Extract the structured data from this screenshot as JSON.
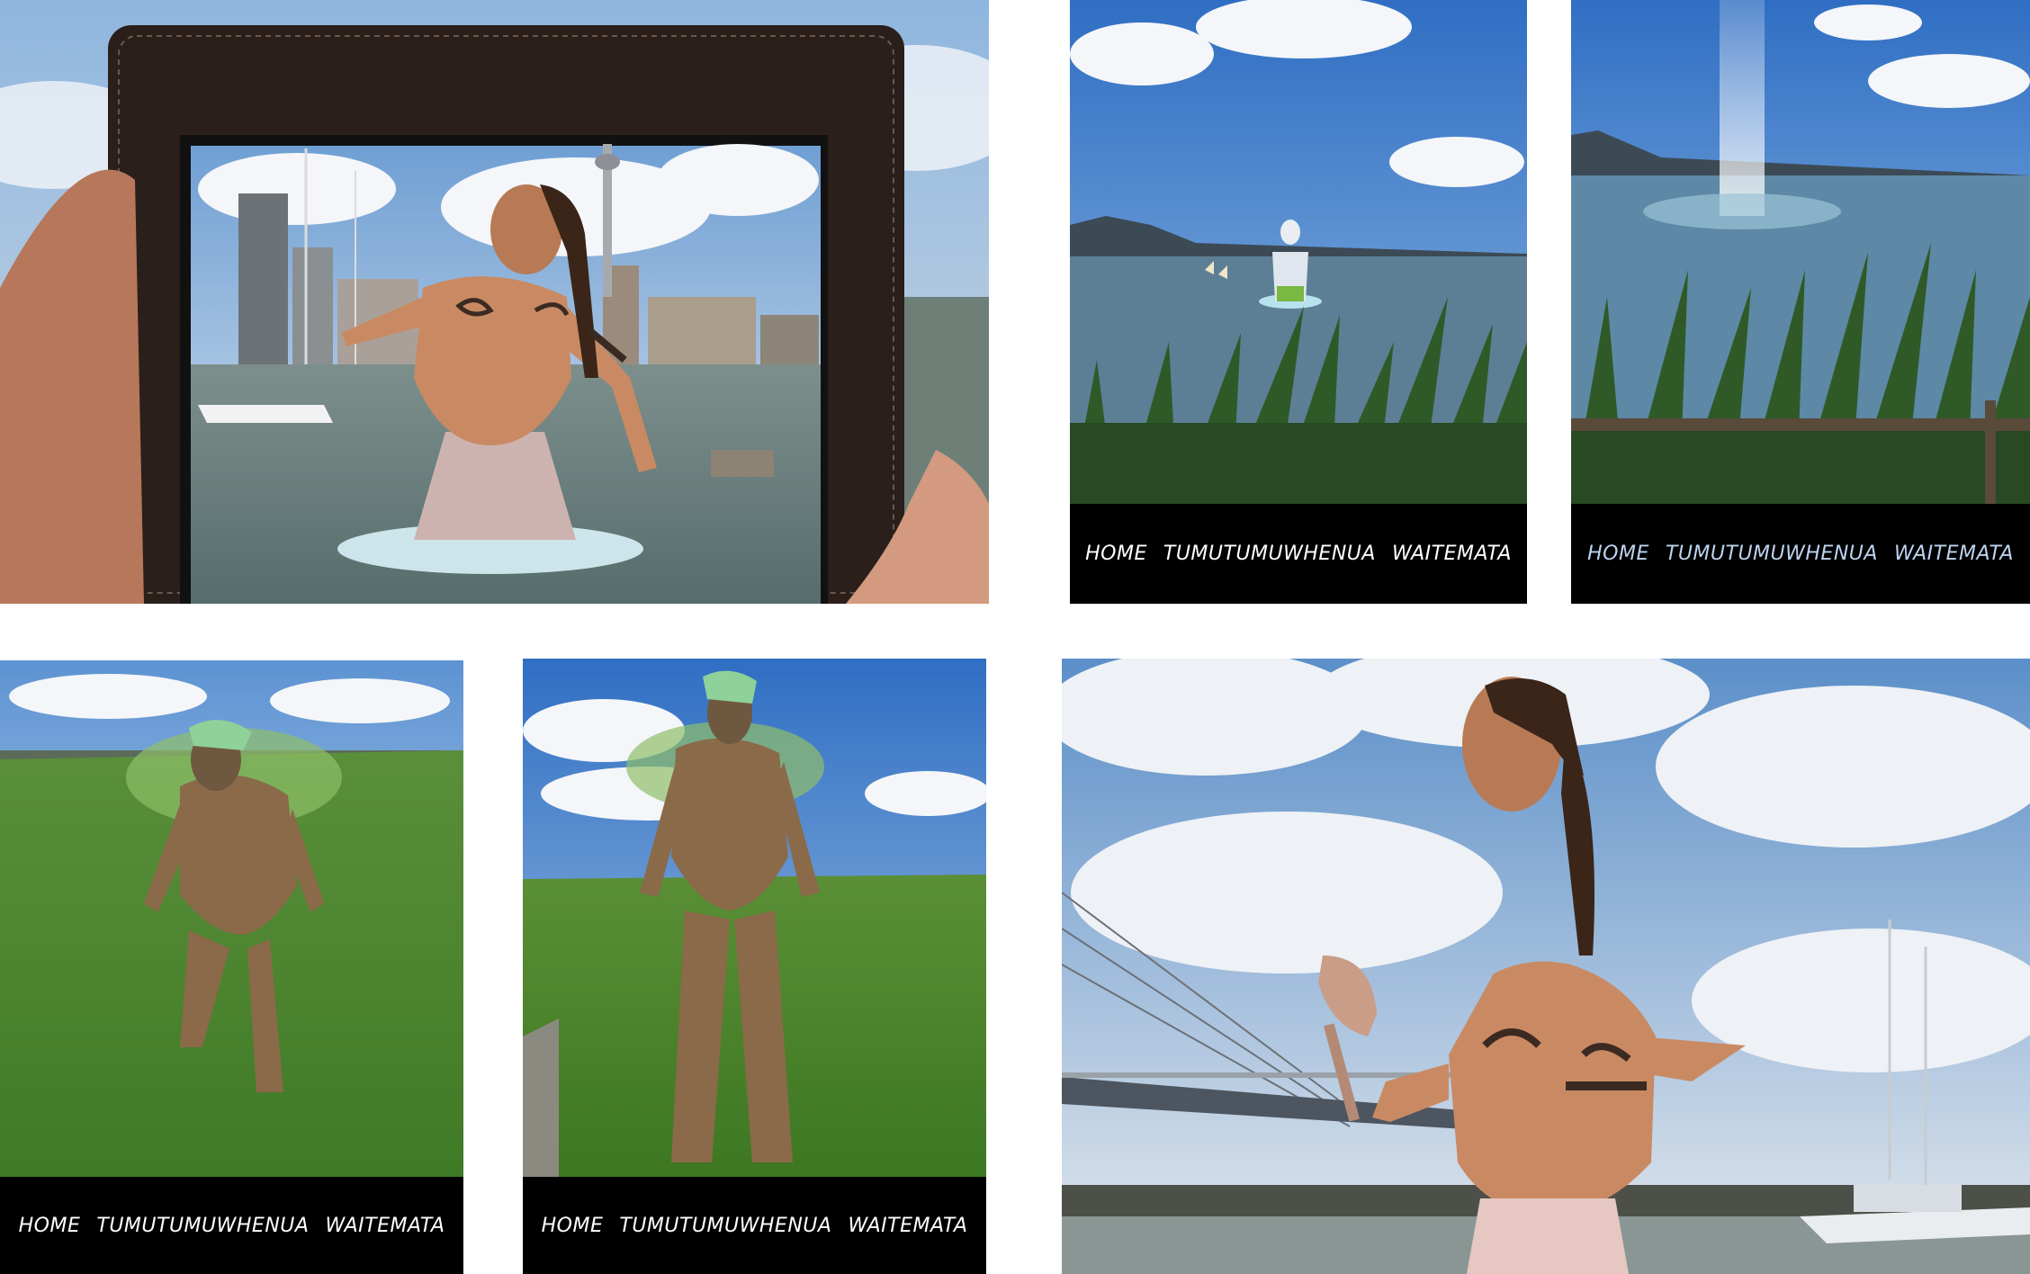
{
  "collage": {
    "panels": [
      {
        "id": "tablet-harbour",
        "scene": "Tablet showing AR Māori warrior in harbour"
      },
      {
        "id": "app-screen-sea-warrior",
        "nav": [
          "HOME",
          "TUMUTUMUWHENUA",
          "WAITEMATA"
        ]
      },
      {
        "id": "app-screen-waterspout",
        "nav": [
          "HOME",
          "TUMUTUMUWHENUA",
          "WAITEMATA"
        ]
      },
      {
        "id": "app-screen-tree-figure-crouch",
        "nav": [
          "HOME",
          "TUMUTUMUWHENUA",
          "WAITEMATA"
        ]
      },
      {
        "id": "app-screen-tree-figure-stand",
        "nav": [
          "HOME",
          "TUMUTUMUWHENUA",
          "WAITEMATA"
        ]
      },
      {
        "id": "warrior-closeup-bridge",
        "scene": "Warrior with patu beside bridge and marina"
      }
    ]
  },
  "nav": {
    "p2": {
      "home": "HOME",
      "tumu": "TUMUTUMUWHENUA",
      "waitemata": "WAITEMATA"
    },
    "p3": {
      "home": "HOME",
      "tumu": "TUMUTUMUWHENUA",
      "waitemata": "WAITEMATA"
    },
    "p4": {
      "home": "HOME",
      "tumu": "TUMUTUMUWHENUA",
      "waitemata": "WAITEMATA"
    },
    "p5": {
      "home": "HOME",
      "tumu": "TUMUTUMUWHENUA",
      "waitemata": "WAITEMATA"
    }
  },
  "colors": {
    "sky": "#4d86c9",
    "cloud": "#eef1f5",
    "sea": "#5d7f96",
    "grass": "#4d8a2f",
    "navbar": "#000000",
    "nav_text": "#ffffff",
    "nav_text_alt": "#bcd3ee",
    "skin": "#c98a63",
    "bark": "#8a6a48",
    "tablet_case": "#2a1f1a"
  }
}
